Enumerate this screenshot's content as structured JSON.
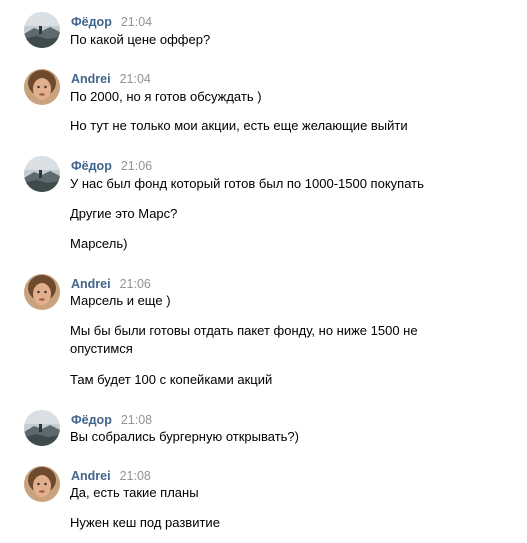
{
  "messages": [
    {
      "author": "Фёдор",
      "time": "21:04",
      "avatar": "fedor-avatar",
      "lines": [
        "По какой цене оффер?"
      ]
    },
    {
      "author": "Andrei",
      "time": "21:04",
      "avatar": "andrei-avatar",
      "lines": [
        "По 2000, но я готов обсуждать )",
        "Но тут не только мои акции, есть еще желающие выйти"
      ]
    },
    {
      "author": "Фёдор",
      "time": "21:06",
      "avatar": "fedor-avatar",
      "lines": [
        "У нас был фонд который готов был по 1000-1500 покупать",
        "Другие это Марс?",
        "Марсель)"
      ]
    },
    {
      "author": "Andrei",
      "time": "21:06",
      "avatar": "andrei-avatar",
      "lines": [
        "Марсель и еще )",
        "Мы бы были готовы отдать пакет фонду, но ниже 1500 не",
        "опустимся",
        "Там будет 100 с копейками акций"
      ]
    },
    {
      "author": "Фёдор",
      "time": "21:08",
      "avatar": "fedor-avatar",
      "lines": [
        "Вы собрались бургерную открывать?)"
      ]
    },
    {
      "author": "Andrei",
      "time": "21:08",
      "avatar": "andrei-avatar",
      "lines": [
        "Да, есть такие планы",
        "Нужен кеш под развитие"
      ]
    }
  ],
  "colors": {
    "author": "#42648b",
    "time": "#939393",
    "text": "#000000"
  }
}
